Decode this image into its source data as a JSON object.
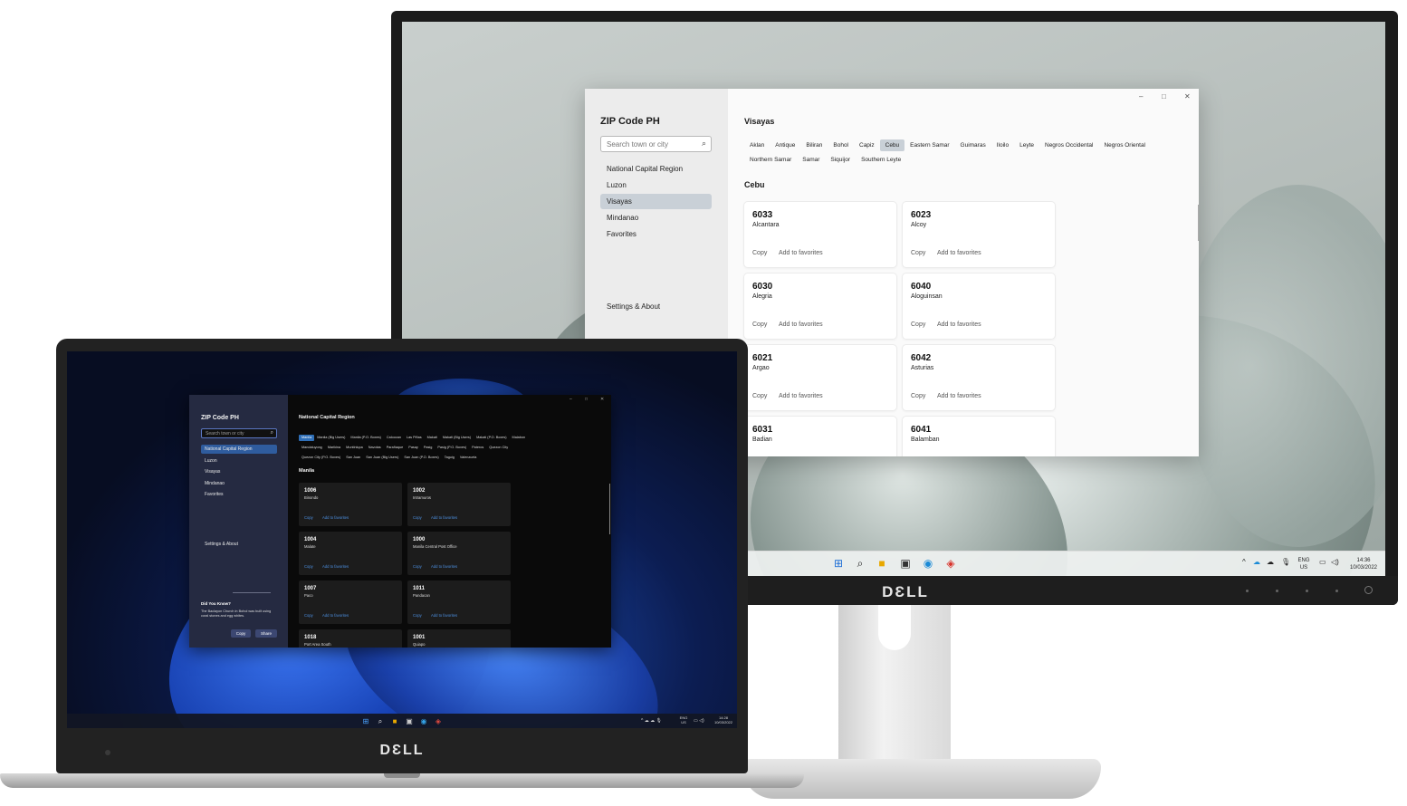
{
  "monitor": {
    "brand": "DƐLL",
    "app": {
      "title": "ZIP Code PH",
      "search_placeholder": "Search town or city",
      "nav": [
        "National Capital Region",
        "Luzon",
        "Visayas",
        "Mindanao",
        "Favorites"
      ],
      "selected_nav": "Visayas",
      "settings_label": "Settings & About",
      "region_title": "Visayas",
      "provinces_row1": [
        "Aklan",
        "Antique",
        "Biliran",
        "Bohol",
        "Capiz",
        "Cebu",
        "Eastern Samar",
        "Guimaras",
        "Iloilo",
        "Leyte",
        "Negros Occidental",
        "Negros Oriental"
      ],
      "provinces_row2": [
        "Northern Samar",
        "Samar",
        "Siquijor",
        "Southern Leyte"
      ],
      "selected_province": "Cebu",
      "province_title": "Cebu",
      "copy_label": "Copy",
      "fav_label": "Add to favorites",
      "cards": [
        {
          "code": "6033",
          "name": "Alcantara"
        },
        {
          "code": "6023",
          "name": "Alcoy"
        },
        {
          "code": "6030",
          "name": "Alegria"
        },
        {
          "code": "6040",
          "name": "Aloguinsan"
        },
        {
          "code": "6021",
          "name": "Argao"
        },
        {
          "code": "6042",
          "name": "Asturias"
        },
        {
          "code": "6031",
          "name": "Badian"
        },
        {
          "code": "6041",
          "name": "Balamban"
        }
      ],
      "window_controls": [
        "–",
        "□",
        "✕"
      ]
    },
    "taskbar": {
      "lang": "ENG",
      "region": "US",
      "time": "14:36",
      "date": "10/03/2022"
    }
  },
  "laptop": {
    "brand": "DƐLL",
    "app": {
      "title": "ZIP Code PH",
      "search_placeholder": "Search town or city",
      "nav": [
        "National Capital Region",
        "Luzon",
        "Visayas",
        "Mindanao",
        "Favorites"
      ],
      "selected_nav": "National Capital Region",
      "settings_label": "Settings & About",
      "did_you_know_title": "Did You Know?",
      "did_you_know_text": "The Baclayon Church in Bohol was built using coral stones and egg whites.",
      "copy_button": "Copy",
      "share_button": "Share",
      "region_title": "National Capital Region",
      "cities_row1": [
        "Manila",
        "Manila (Big Users)",
        "Manila (P.O. Boxes)",
        "Caloocan",
        "Las Piñas",
        "Makati",
        "Makati (Big Users)",
        "Makati (P.O. Boxes)",
        "Malabon"
      ],
      "cities_row2": [
        "Mandaluyong",
        "Marikina",
        "Muntinlupa",
        "Navotas",
        "Parañaque",
        "Pasay",
        "Pasig",
        "Pasig (P.O. Boxes)",
        "Pateros",
        "Quezon City"
      ],
      "cities_row3": [
        "Quezon City (P.O. Boxes)",
        "San Juan",
        "San Juan (Big Users)",
        "San Juan (P.O. Boxes)",
        "Taguig",
        "Valenzuela"
      ],
      "selected_city": "Manila",
      "city_title": "Manila",
      "copy_label": "Copy",
      "fav_label": "Add to favorites",
      "cards": [
        {
          "code": "1006",
          "name": "Binondo"
        },
        {
          "code": "1002",
          "name": "Intramuros"
        },
        {
          "code": "1004",
          "name": "Malate"
        },
        {
          "code": "1000",
          "name": "Manila Central Post Office"
        },
        {
          "code": "1007",
          "name": "Paco"
        },
        {
          "code": "1011",
          "name": "Pandacan"
        },
        {
          "code": "1018",
          "name": "Port Area South"
        },
        {
          "code": "1001",
          "name": "Quiapo"
        }
      ],
      "window_controls": [
        "–",
        "□",
        "✕"
      ]
    },
    "taskbar": {
      "lang": "ENG",
      "region": "US",
      "time": "14:28",
      "date": "10/03/2022"
    }
  },
  "colors": {
    "light_accent": "#c9d0d7",
    "dark_accent": "#2f6fb8",
    "link_blue": "#4c8fe0"
  }
}
